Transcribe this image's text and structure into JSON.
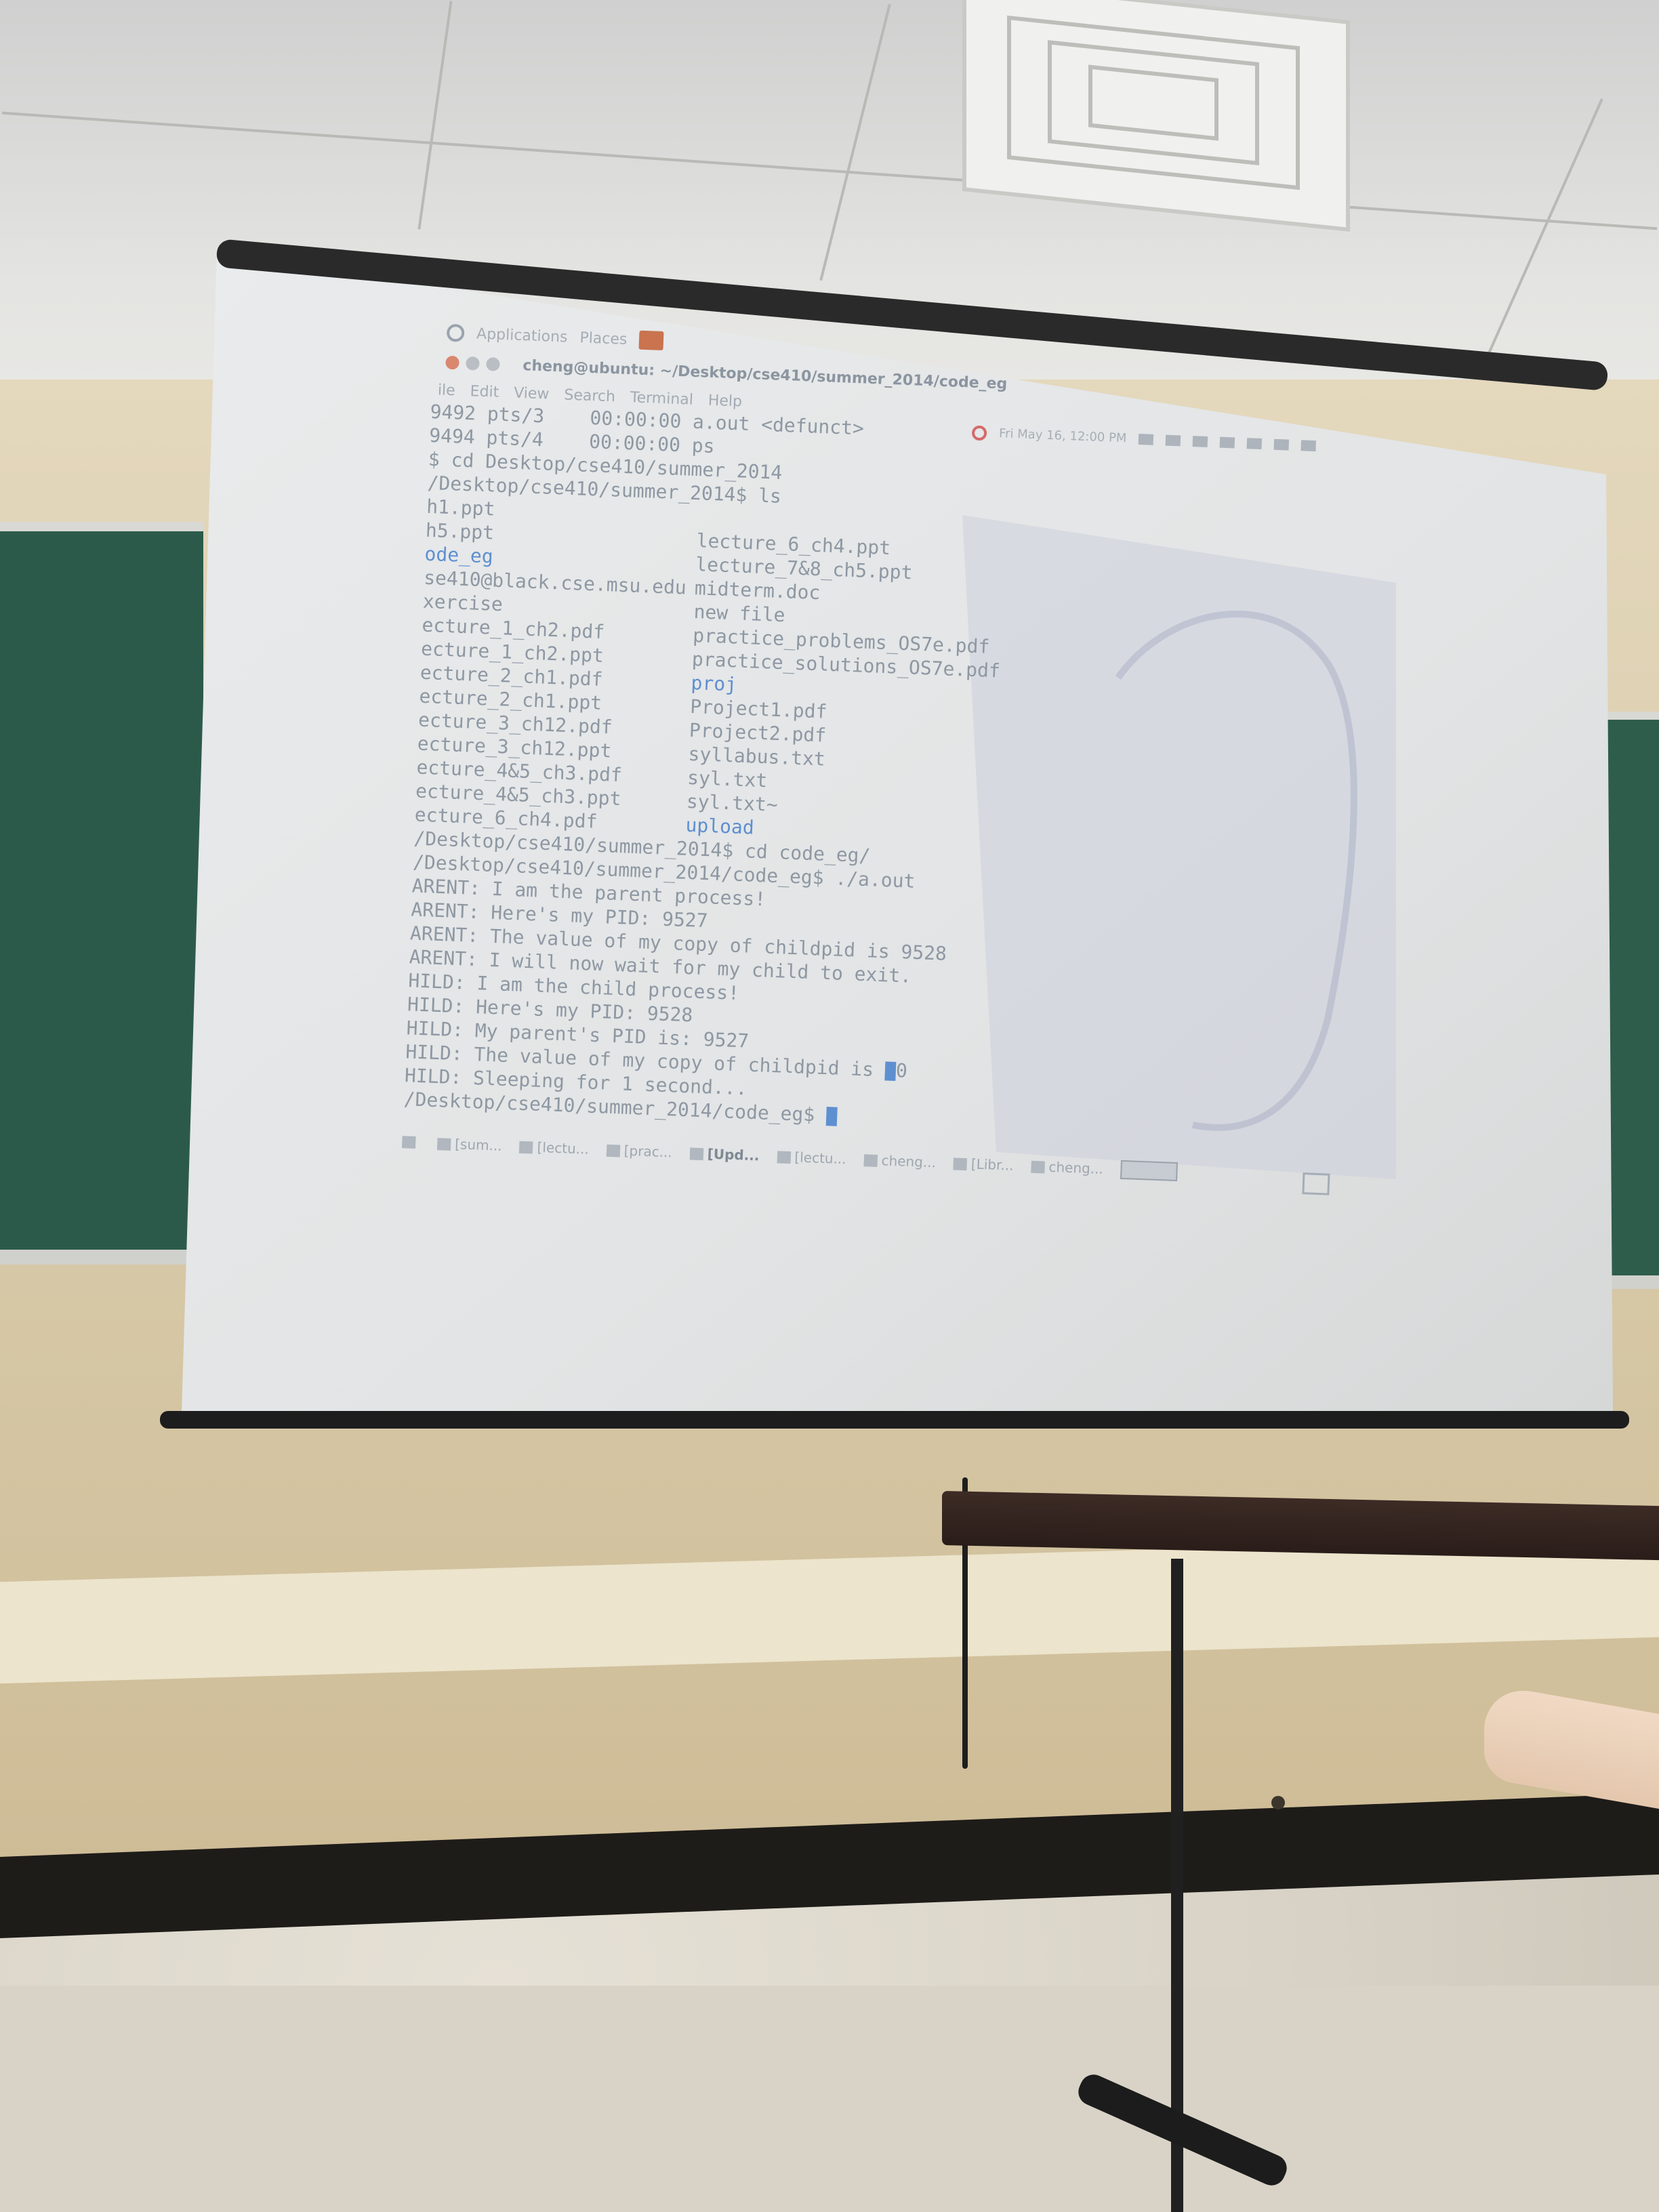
{
  "desktop": {
    "panel": {
      "applications": "Applications",
      "places": "Places"
    },
    "window": {
      "title": "cheng@ubuntu: ~/Desktop/cse410/summer_2014/code_eg",
      "menu": [
        "ile",
        "Edit",
        "View",
        "Search",
        "Terminal",
        "Help"
      ]
    },
    "tray": {
      "clock": "Fri May 16, 12:00 PM"
    },
    "terminal": {
      "head_lines": [
        "9492 pts/3    00:00:00 a.out <defunct>",
        "9494 pts/4    00:00:00 ps",
        "$ cd Desktop/cse410/summer_2014",
        "/Desktop/cse410/summer_2014$ ls"
      ],
      "ls_rows": [
        {
          "a": "h1.ppt",
          "b": "",
          "a_dir": false,
          "b_dir": false
        },
        {
          "a": "h5.ppt",
          "b": "lecture_6_ch4.ppt",
          "a_dir": false,
          "b_dir": false
        },
        {
          "a": "ode_eg",
          "b": "lecture_7&8_ch5.ppt",
          "a_dir": true,
          "b_dir": false
        },
        {
          "a": "se410@black.cse.msu.edu",
          "b": "midterm.doc",
          "a_dir": false,
          "b_dir": false
        },
        {
          "a": "xercise",
          "b": "new file",
          "a_dir": false,
          "b_dir": false
        },
        {
          "a": "ecture_1_ch2.pdf",
          "b": "practice_problems_OS7e.pdf",
          "a_dir": false,
          "b_dir": false
        },
        {
          "a": "ecture_1_ch2.ppt",
          "b": "practice_solutions_OS7e.pdf",
          "a_dir": false,
          "b_dir": false
        },
        {
          "a": "ecture_2_ch1.pdf",
          "b": "proj",
          "a_dir": false,
          "b_dir": true
        },
        {
          "a": "ecture_2_ch1.ppt",
          "b": "Project1.pdf",
          "a_dir": false,
          "b_dir": false
        },
        {
          "a": "ecture_3_ch12.pdf",
          "b": "Project2.pdf",
          "a_dir": false,
          "b_dir": false
        },
        {
          "a": "ecture_3_ch12.ppt",
          "b": "syllabus.txt",
          "a_dir": false,
          "b_dir": false
        },
        {
          "a": "ecture_4&5_ch3.pdf",
          "b": "syl.txt",
          "a_dir": false,
          "b_dir": false
        },
        {
          "a": "ecture_4&5_ch3.ppt",
          "b": "syl.txt~",
          "a_dir": false,
          "b_dir": false
        },
        {
          "a": "ecture_6_ch4.pdf",
          "b": "upload",
          "a_dir": false,
          "b_dir": true
        }
      ],
      "tail_lines": [
        "/Desktop/cse410/summer_2014$ cd code_eg/",
        "/Desktop/cse410/summer_2014/code_eg$ ./a.out",
        "ARENT: I am the parent process!",
        "ARENT: Here's my PID: 9527",
        "ARENT: The value of my copy of childpid is 9528",
        "ARENT: I will now wait for my child to exit.",
        "HILD: I am the child process!",
        "HILD: Here's my PID: 9528",
        "HILD: My parent's PID is: 9527"
      ],
      "child_value_prefix": "HILD: The value of my copy of childpid is",
      "child_value_suffix": "0",
      "sleep_line": "HILD: Sleeping for 1 second...",
      "prompt": "/Desktop/cse410/summer_2014/code_eg$ "
    },
    "taskbar": [
      {
        "label": "[sum...",
        "active": false
      },
      {
        "label": "[lectu...",
        "active": false
      },
      {
        "label": "[prac...",
        "active": false
      },
      {
        "label": "[Upd...",
        "active": true
      },
      {
        "label": "[lectu...",
        "active": false
      },
      {
        "label": "cheng...",
        "active": false
      },
      {
        "label": "[Libr...",
        "active": false
      },
      {
        "label": "cheng...",
        "active": false
      }
    ]
  }
}
